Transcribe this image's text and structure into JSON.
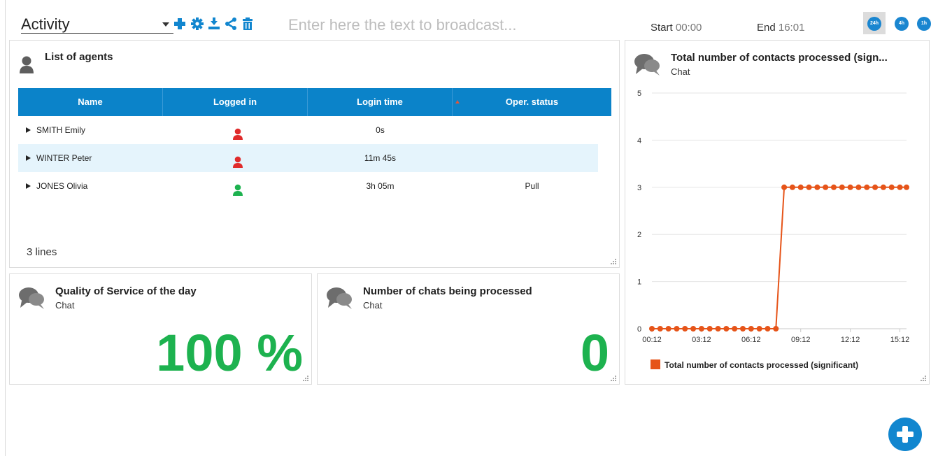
{
  "toolbar": {
    "dashboard_name": "Activity",
    "broadcast_placeholder": "Enter here the text to broadcast...",
    "start_label": "Start",
    "start_time": "00:00",
    "end_label": "End",
    "end_time": "16:01",
    "periods": [
      "24h",
      "4h",
      "1h"
    ],
    "selected_period": "24h",
    "icons": [
      "plus-icon",
      "gear-icon",
      "download-icon",
      "share-icon",
      "trash-icon"
    ],
    "accent_color": "#1186cf"
  },
  "agents_panel": {
    "title": "List of agents",
    "columns": [
      "Name",
      "Logged in",
      "Login time",
      "Oper. status"
    ],
    "rows": [
      {
        "name": "SMITH Emily",
        "logged_in": "red",
        "login_time": "0s",
        "oper_status": ""
      },
      {
        "name": "WINTER Peter",
        "logged_in": "red",
        "login_time": "11m 45s",
        "oper_status": ""
      },
      {
        "name": "JONES Olivia",
        "logged_in": "green",
        "login_time": "3h 05m",
        "oper_status": "Pull"
      }
    ],
    "footer": "3 lines",
    "status_colors": {
      "red": "#e02b2b",
      "green": "#1db24f"
    }
  },
  "qos_panel": {
    "title": "Quality of Service of the day",
    "subtitle": "Chat",
    "value": "100 %"
  },
  "chats_panel": {
    "title": "Number of chats being processed",
    "subtitle": "Chat",
    "value": "0"
  },
  "contacts_panel": {
    "title": "Total number of contacts processed (sign...",
    "subtitle": "Chat"
  },
  "chart_data": {
    "type": "line",
    "title": "Total number of contacts processed (sign...",
    "subtitle": "Chat",
    "xlabel": "",
    "ylabel": "",
    "x_ticks": [
      "00:12",
      "03:12",
      "06:12",
      "09:12",
      "12:12",
      "15:12"
    ],
    "y_ticks": [
      0,
      1,
      2,
      3,
      4,
      5
    ],
    "ylim": [
      0,
      5
    ],
    "xlim_hours": [
      0.2,
      15.6
    ],
    "grid": true,
    "legend_position": "bottom",
    "series": [
      {
        "name": "Total number of contacts processed (significant)",
        "color": "#e65419",
        "x": [
          "00:12",
          "00:42",
          "01:12",
          "01:42",
          "02:12",
          "02:42",
          "03:12",
          "03:42",
          "04:12",
          "04:42",
          "05:12",
          "05:42",
          "06:12",
          "06:42",
          "07:12",
          "07:42",
          "08:12",
          "08:42",
          "09:12",
          "09:42",
          "10:12",
          "10:42",
          "11:12",
          "11:42",
          "12:12",
          "12:42",
          "13:12",
          "13:42",
          "14:12",
          "14:42",
          "15:12",
          "15:36"
        ],
        "values": [
          0,
          0,
          0,
          0,
          0,
          0,
          0,
          0,
          0,
          0,
          0,
          0,
          0,
          0,
          0,
          0,
          3,
          3,
          3,
          3,
          3,
          3,
          3,
          3,
          3,
          3,
          3,
          3,
          3,
          3,
          3,
          3
        ]
      }
    ]
  },
  "fab": {
    "icon": "plus-icon"
  }
}
